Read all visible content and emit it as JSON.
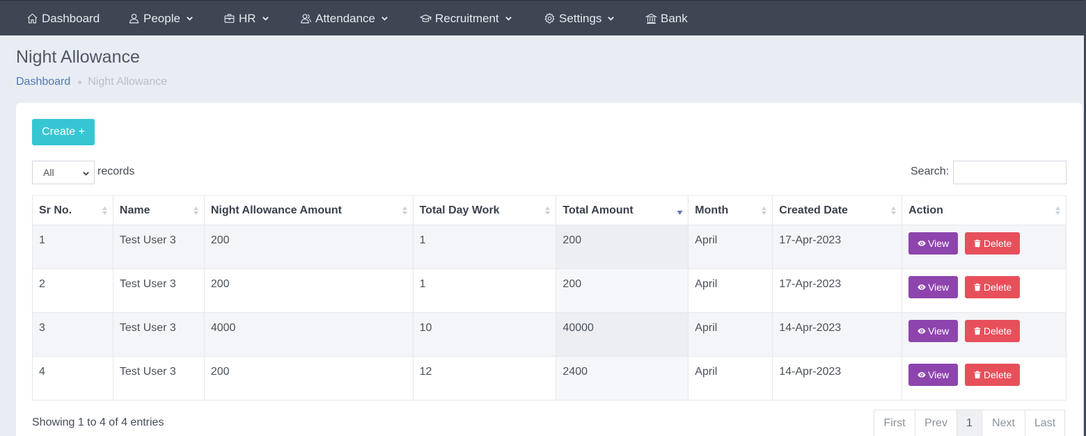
{
  "nav": {
    "items": [
      {
        "label": "Dashboard",
        "icon": "home-icon",
        "dropdown": false
      },
      {
        "label": "People",
        "icon": "user-icon",
        "dropdown": true
      },
      {
        "label": "HR",
        "icon": "briefcase-icon",
        "dropdown": true
      },
      {
        "label": "Attendance",
        "icon": "users-icon",
        "dropdown": true
      },
      {
        "label": "Recruitment",
        "icon": "graduation-cap-icon",
        "dropdown": true
      },
      {
        "label": "Settings",
        "icon": "gear-icon",
        "dropdown": true
      },
      {
        "label": "Bank",
        "icon": "bank-icon",
        "dropdown": false
      }
    ]
  },
  "page": {
    "title": "Night Allowance",
    "breadcrumb": {
      "home": "Dashboard",
      "current": "Night Allowance"
    }
  },
  "toolbar": {
    "create_label": "Create +",
    "length_value": "All",
    "length_suffix": "records",
    "search_label": "Search:",
    "search_value": ""
  },
  "table": {
    "columns": [
      "Sr No.",
      "Name",
      "Night Allowance Amount",
      "Total Day Work",
      "Total Amount",
      "Month",
      "Created Date",
      "Action"
    ],
    "sorted_column": "Total Amount",
    "sort_direction": "descending",
    "rows": [
      {
        "sr": "1",
        "name": "Test User 3",
        "night_amount": "200",
        "day_work": "1",
        "total": "200",
        "month": "April",
        "created": "17-Apr-2023"
      },
      {
        "sr": "2",
        "name": "Test User 3",
        "night_amount": "200",
        "day_work": "1",
        "total": "200",
        "month": "April",
        "created": "17-Apr-2023"
      },
      {
        "sr": "3",
        "name": "Test User 3",
        "night_amount": "4000",
        "day_work": "10",
        "total": "40000",
        "month": "April",
        "created": "14-Apr-2023"
      },
      {
        "sr": "4",
        "name": "Test User 3",
        "night_amount": "200",
        "day_work": "12",
        "total": "2400",
        "month": "April",
        "created": "14-Apr-2023"
      }
    ],
    "view_label": "View",
    "delete_label": "Delete"
  },
  "footer": {
    "info": "Showing 1 to 4 of 4 entries",
    "pagination": [
      "First",
      "Prev",
      "1",
      "Next",
      "Last"
    ],
    "current_page": "1"
  },
  "colors": {
    "navbar": "#3e4654",
    "create": "#36c6d3",
    "view": "#8e44ad",
    "delete": "#e7505a",
    "link": "#4e79b5"
  }
}
